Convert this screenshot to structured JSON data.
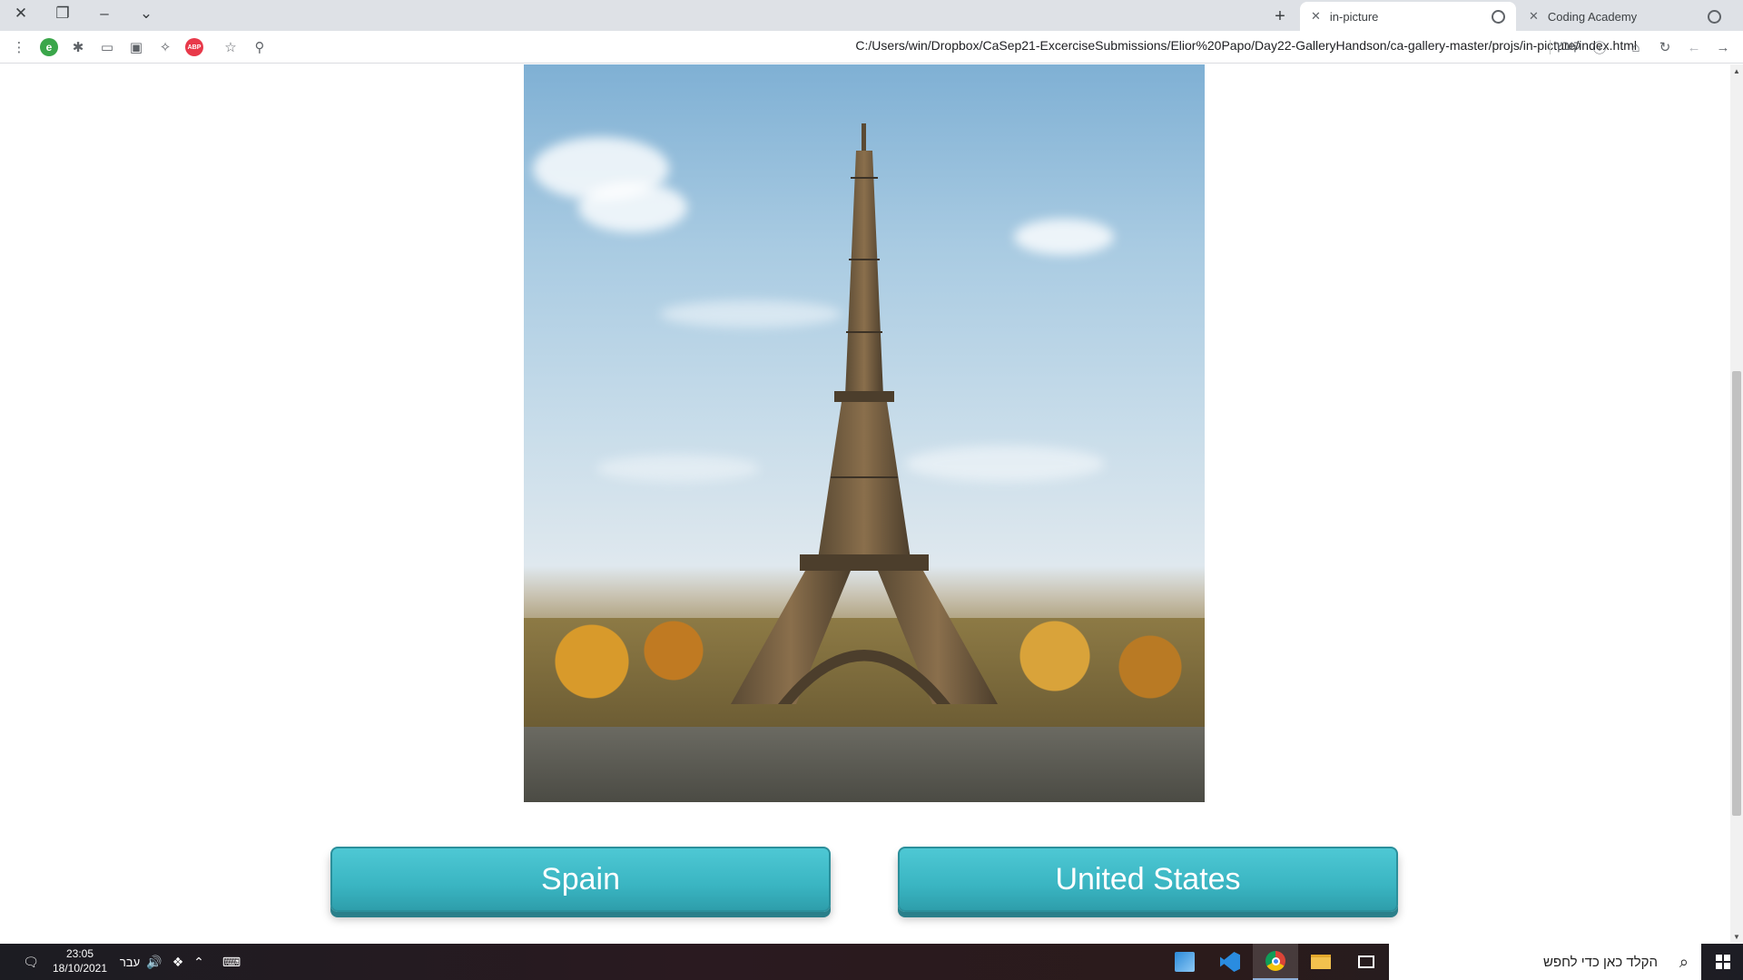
{
  "browser": {
    "tabs": [
      {
        "title": "in-picture",
        "active": true
      },
      {
        "title": "Coding Academy",
        "active": false
      }
    ],
    "new_tab_icon": "plus-icon",
    "address": "C:/Users/win/Dropbox/CaSep21-ExcerciseSubmissions/Elior%20Papo/Day22-GalleryHandson/ca-gallery-master/projs/in-picture/index.html",
    "address_label": "קובץ",
    "extension_e_label": "e",
    "extension_abp_label": "ABP"
  },
  "page": {
    "picture_alt": "Eiffel Tower",
    "answers": [
      {
        "label": "Spain"
      },
      {
        "label": "United States"
      }
    ],
    "accent_color": "#3ab5c2"
  },
  "taskbar": {
    "time": "23:05",
    "date": "18/10/2021",
    "language": "עבר",
    "search_placeholder": "הקלד כאן כדי לחפש"
  }
}
